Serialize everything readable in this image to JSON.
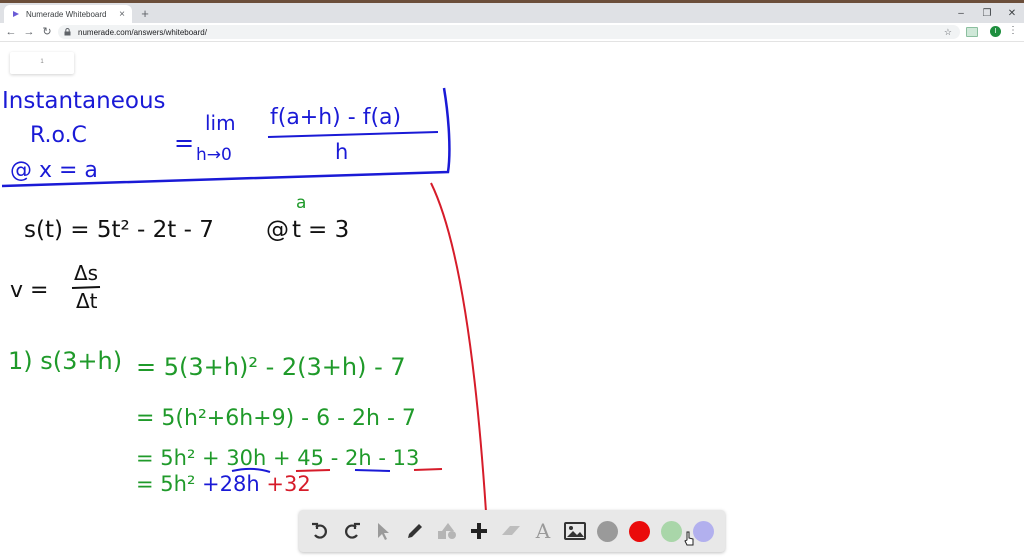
{
  "browser": {
    "tab_title": "Numerade Whiteboard",
    "tab_close": "×",
    "new_tab": "+",
    "url": "numerade.com/answers/whiteboard/",
    "window_controls": [
      "–",
      "❐",
      "✕"
    ],
    "nav": {
      "back": "←",
      "forward": "→",
      "reload": "↻"
    },
    "star": "☆",
    "avatar_letter": "I",
    "menu": "⋮"
  },
  "page_tab": {
    "label": "1"
  },
  "board": {
    "colors": {
      "blue": "#1a1ad6",
      "black": "#111111",
      "green": "#1f9a2a",
      "red": "#d61c2a"
    },
    "definition": {
      "line1": "Instantaneous",
      "line2": "R.o.C",
      "line3": "@ x = a",
      "equals": "=",
      "lim": "lim",
      "lim_sub": "h→0",
      "numerator": "f(a+h) - f(a)",
      "denominator": "h"
    },
    "function_line": "s(t) = 5t² - 2t - 7",
    "point_at": "@",
    "point_var": "t",
    "point_eq": "= 3",
    "point_label": "a",
    "velocity": {
      "lhs": "v =",
      "num": "Δs",
      "den": "Δt"
    },
    "steps": [
      {
        "lhs": "1) s(3+h)",
        "rhs": "= 5(3+h)² - 2(3+h) - 7"
      },
      {
        "rhs": "= 5(h²+6h+9) - 6 - 2h - 7"
      },
      {
        "rhs_parts": [
          "= 5h² + 30h + ",
          "45",
          " - ",
          "2h",
          " - ",
          "13"
        ]
      },
      {
        "rhs_parts": [
          "= 5h² ",
          "+28h",
          " ",
          "+32"
        ]
      }
    ]
  },
  "toolbar": {
    "tools": [
      "undo-icon",
      "redo-icon",
      "pointer-icon",
      "pencil-icon",
      "shapes-icon",
      "plus-icon",
      "eraser-icon",
      "text-icon",
      "image-icon"
    ],
    "text_tool_glyph": "A",
    "colors": [
      "#9a9a9a",
      "#ea0b0b",
      "#a9d6a9",
      "#b2b0ee"
    ]
  }
}
